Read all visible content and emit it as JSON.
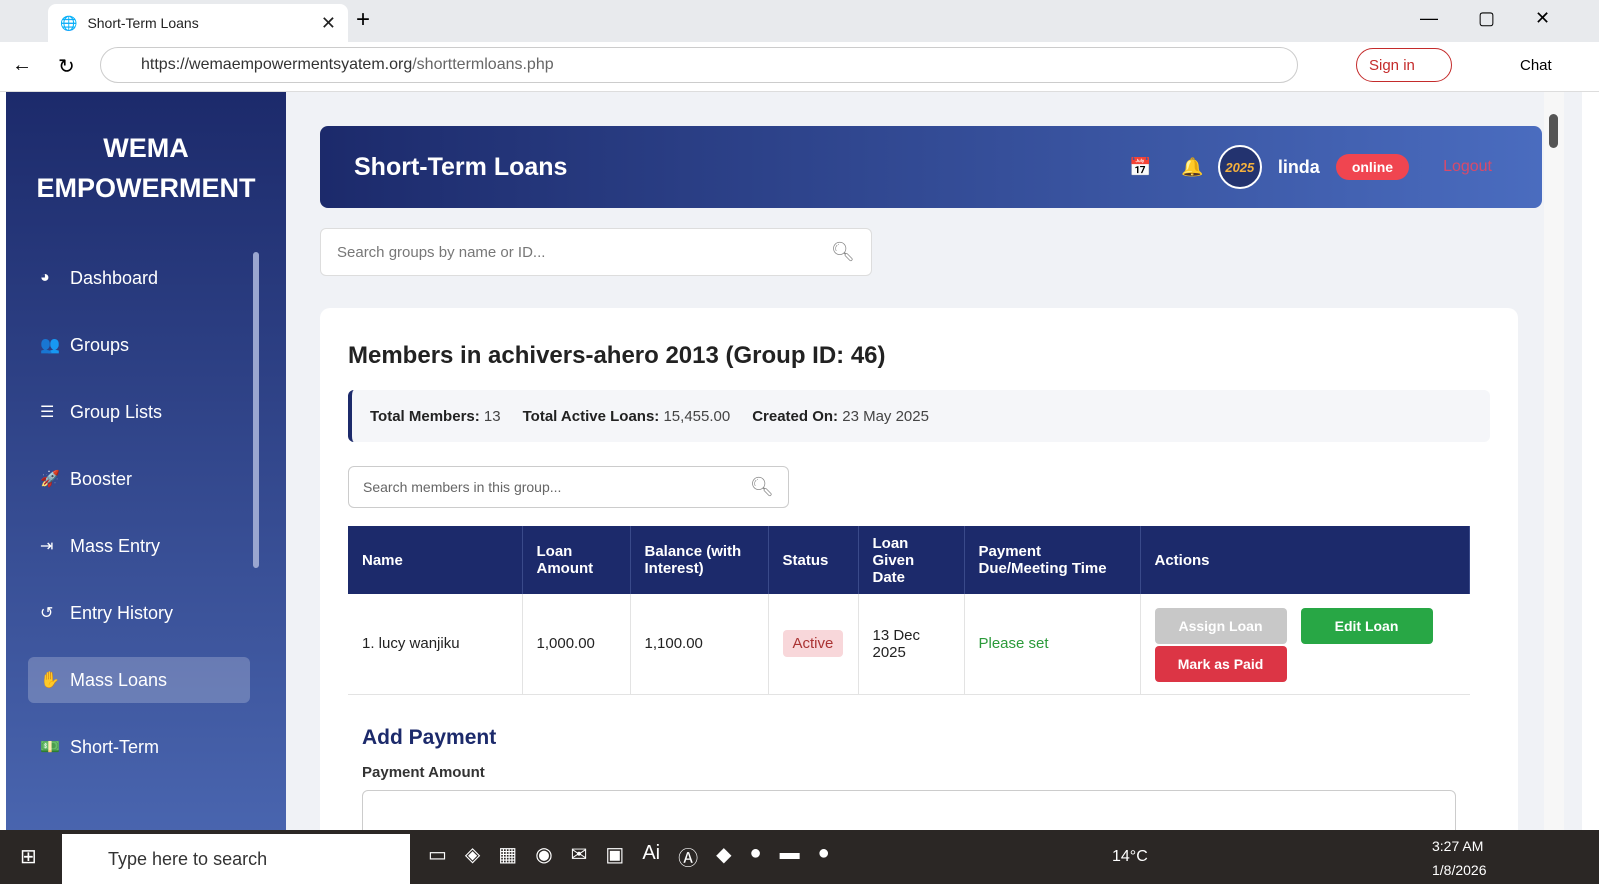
{
  "browser": {
    "tab_title": "Short-Term Loans",
    "url_host": "https://wemaempowermentsyatem.org",
    "url_path": "/shorttermloans.php",
    "sign_in": "Sign in",
    "chat": "Chat"
  },
  "sidebar": {
    "brand_line1": "WEMA",
    "brand_line2": "EMPOWERMENT",
    "items": [
      {
        "label": "Dashboard",
        "icon": "◕"
      },
      {
        "label": "Groups",
        "icon": "👥"
      },
      {
        "label": "Group Lists",
        "icon": "☰"
      },
      {
        "label": "Booster",
        "icon": "🚀"
      },
      {
        "label": "Mass Entry",
        "icon": "⇥"
      },
      {
        "label": "Entry History",
        "icon": "↺"
      },
      {
        "label": "Mass Loans",
        "icon": "✋"
      },
      {
        "label": "Short-Term",
        "icon": "💵"
      }
    ]
  },
  "header": {
    "title": "Short-Term Loans",
    "avatar_text": "2025",
    "user": "linda",
    "status": "online",
    "logout": "Logout"
  },
  "group_search": {
    "placeholder": "Search groups by name or ID..."
  },
  "group": {
    "title": "Members in achivers-ahero 2013 (Group ID: 46)",
    "total_members_label": "Total Members:",
    "total_members": "13",
    "active_loans_label": "Total Active Loans:",
    "active_loans": "15,455.00",
    "created_label": "Created On:",
    "created": "23 May 2025"
  },
  "member_search": {
    "placeholder": "Search members in this group..."
  },
  "table": {
    "headers": [
      "Name",
      "Loan Amount",
      "Balance (with Interest)",
      "Status",
      "Loan Given Date",
      "Payment Due/Meeting Time",
      "Actions"
    ],
    "rows": [
      {
        "name": "1. lucy wanjiku",
        "amount": "1,000.00",
        "balance": "1,100.00",
        "status": "Active",
        "date": "13 Dec 2025",
        "due": "Please set"
      }
    ],
    "actions": {
      "assign": "Assign Loan",
      "edit": "Edit Loan",
      "paid": "Mark as Paid"
    }
  },
  "payment": {
    "title": "Add Payment",
    "amount_label": "Payment Amount"
  },
  "taskbar": {
    "search": "Type here to search",
    "temp": "14°C",
    "time": "3:27 AM",
    "date": "1/8/2026"
  }
}
